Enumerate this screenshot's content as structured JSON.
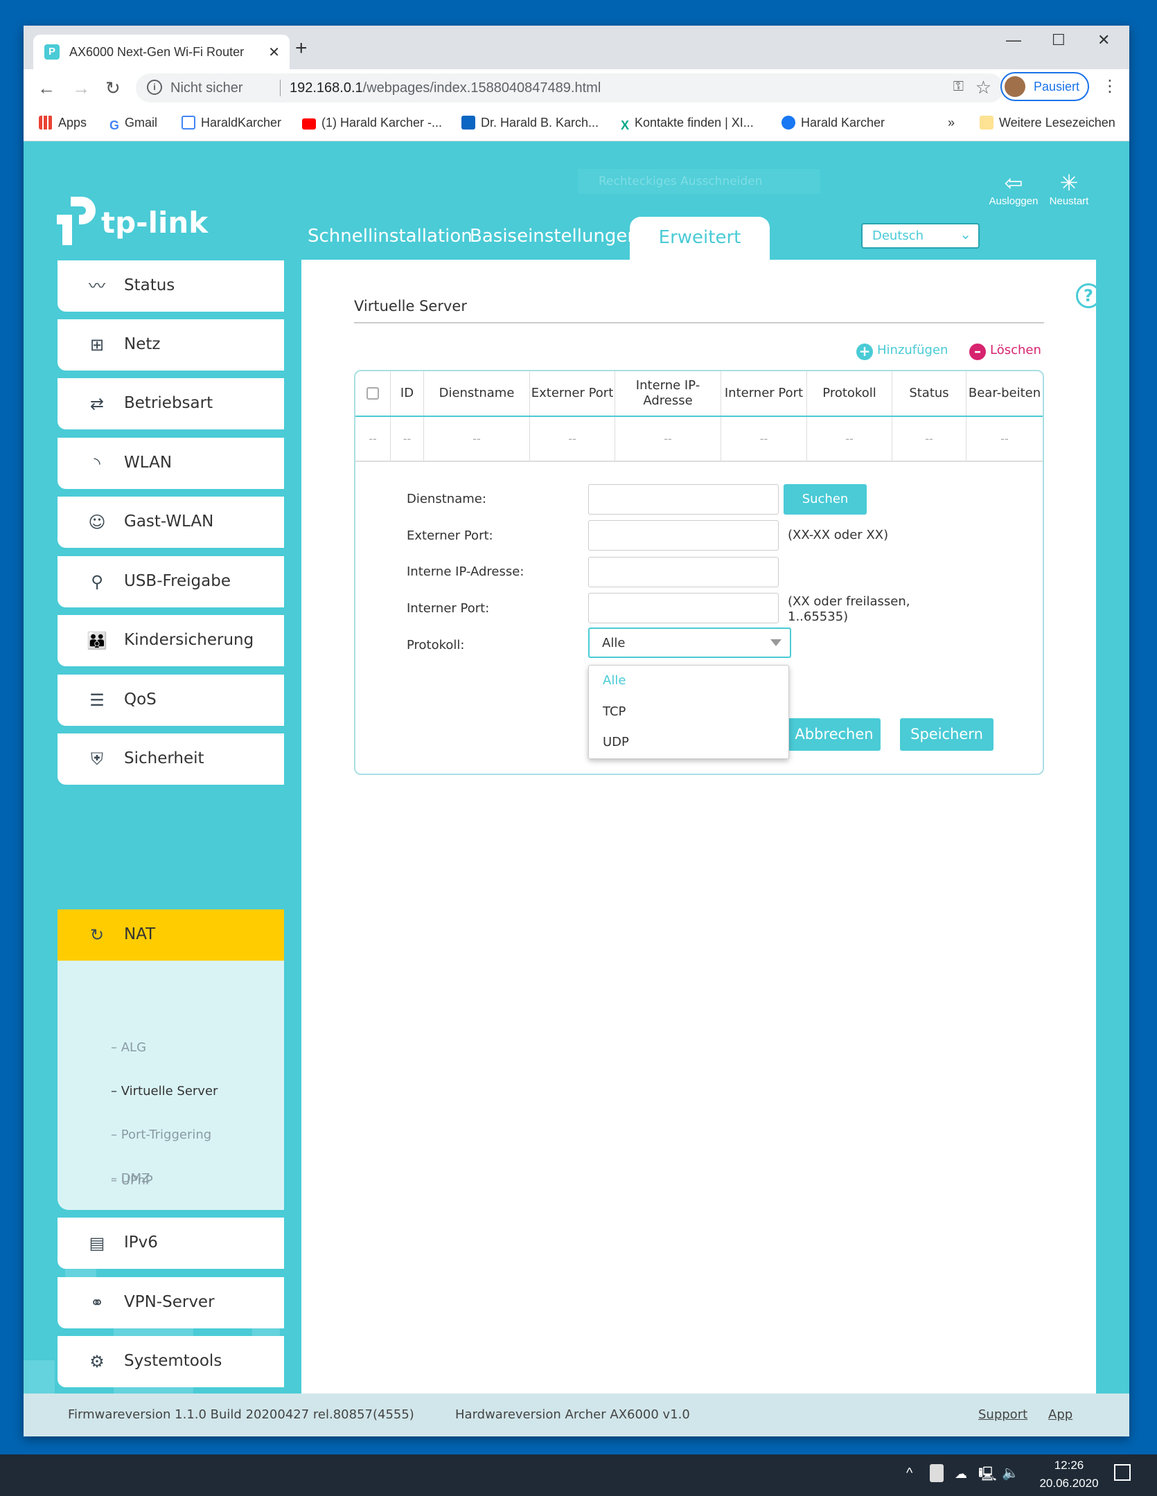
{
  "browser": {
    "tab_title": "AX6000 Next-Gen Wi-Fi Router",
    "security": "Nicht sicher",
    "url_host": "192.168.0.1",
    "url_path": "/webpages/index.1588040847489.html",
    "profile": "Pausiert",
    "bookmarks": [
      "Apps",
      "Gmail",
      "HaraldKarcher",
      "(1) Harald Karcher -...",
      "Dr. Harald B. Karch...",
      "Kontakte finden | XI...",
      "Harald Karcher"
    ],
    "more": "»",
    "other_bookmarks": "Weitere Lesezeichen"
  },
  "header": {
    "logo": "tp-link",
    "tabs": [
      "Schnellinstallation",
      "Basiseinstellungen",
      "Erweitert"
    ],
    "ghost": "Rechteckiges Ausschneiden",
    "language": "Deutsch",
    "logout": "Ausloggen",
    "reboot": "Neustart"
  },
  "sidebar": {
    "items": [
      {
        "label": "Status",
        "icon": "pulse-icon"
      },
      {
        "label": "Netz",
        "icon": "network-icon"
      },
      {
        "label": "Betriebsart",
        "icon": "mode-icon"
      },
      {
        "label": "WLAN",
        "icon": "wifi-icon"
      },
      {
        "label": "Gast-WLAN",
        "icon": "guest-icon"
      },
      {
        "label": "USB-Freigabe",
        "icon": "usb-icon"
      },
      {
        "label": "Kindersicherung",
        "icon": "parental-icon"
      },
      {
        "label": "QoS",
        "icon": "qos-icon"
      },
      {
        "label": "Sicherheit",
        "icon": "shield-icon"
      },
      {
        "label": "NAT",
        "icon": "nat-icon"
      },
      {
        "label": "IPv6",
        "icon": "ipv6-icon"
      },
      {
        "label": "VPN-Server",
        "icon": "vpn-icon"
      },
      {
        "label": "Systemtools",
        "icon": "gear-icon"
      }
    ],
    "sub_items": [
      "ALG",
      "Virtuelle Server",
      "Port-Triggering",
      "DMZ",
      "UPnP"
    ],
    "sub_dash": "–"
  },
  "main": {
    "title": "Virtuelle Server",
    "add": "Hinzufügen",
    "delete": "Löschen",
    "columns": [
      "ID",
      "Dienstname",
      "Externer Port",
      "Interne IP-Adresse",
      "Interner Port",
      "Protokoll",
      "Status",
      "Bear-beiten"
    ],
    "empty": "--",
    "form": {
      "service_label": "Dienstname:",
      "search": "Suchen",
      "ext_label": "Externer Port:",
      "ext_hint": "(XX-XX oder XX)",
      "ip_label": "Interne IP-Adresse:",
      "int_label": "Interner Port:",
      "int_hint1": "(XX oder freilassen,",
      "int_hint2": "1..65535)",
      "proto_label": "Protokoll:",
      "proto_value": "Alle",
      "options": [
        "Alle",
        "TCP",
        "UDP"
      ],
      "cancel": "Abbrechen",
      "save": "Speichern"
    }
  },
  "footer": {
    "firmware": "Firmwareversion 1.1.0 Build 20200427 rel.80857(4555)",
    "hardware": "Hardwareversion Archer AX6000 v1.0",
    "support": "Support",
    "app": "App"
  },
  "taskbar": {
    "time": "12:26",
    "date": "20.06.2020"
  },
  "colors": {
    "teal": "#4acbd6",
    "yellow": "#ffcc00",
    "delete": "#d6246e"
  }
}
